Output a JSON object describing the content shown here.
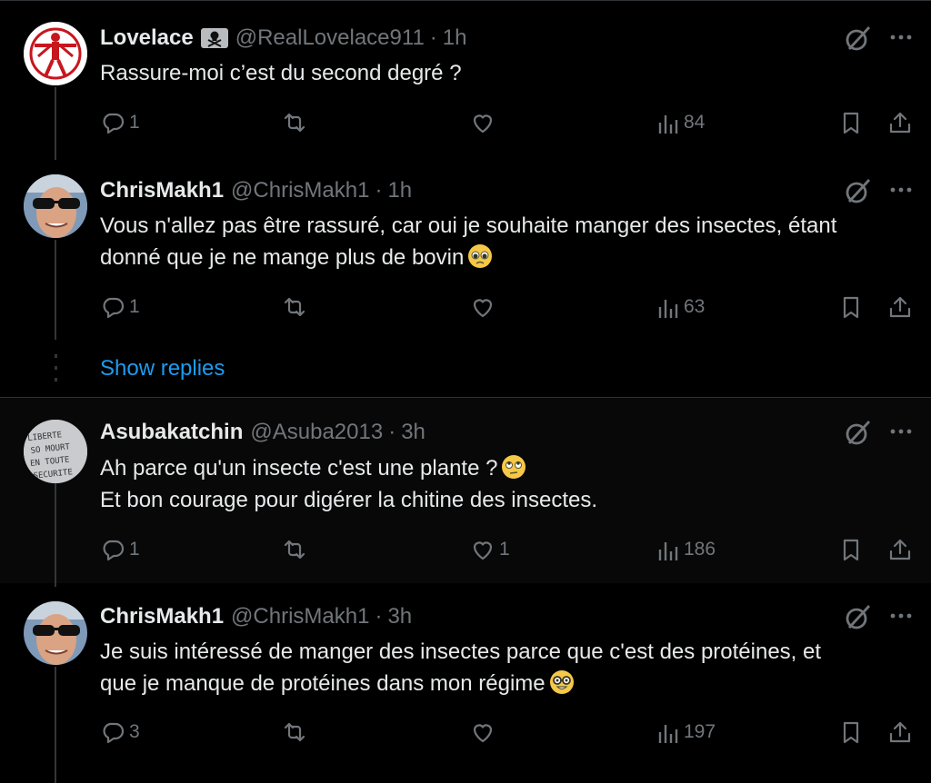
{
  "tweets": [
    {
      "name": "Lovelace",
      "handle": "@RealLovelace911",
      "time": "1h",
      "text_lines": [
        "Rassure-moi c’est du second degré ?"
      ],
      "reply_count": "1",
      "retweet_count": "",
      "like_count": "",
      "view_count": "84"
    },
    {
      "name": "ChrisMakh1",
      "handle": "@ChrisMakh1",
      "time": "1h",
      "text_lines": [
        "Vous n'allez pas être rassuré, car oui je souhaite manger des insectes, étant",
        "donné que je ne mange plus de bovin"
      ],
      "emoji": "pleading-face",
      "reply_count": "1",
      "retweet_count": "",
      "like_count": "",
      "view_count": "63"
    },
    {
      "name": "Asubakatchin",
      "handle": "@Asuba2013",
      "time": "3h",
      "text_lines": [
        "Ah parce qu'un insecte c'est une plante ?",
        "Et bon courage pour digérer la chitine des insectes."
      ],
      "emoji": "face-with-rolling-eyes",
      "reply_count": "1",
      "retweet_count": "",
      "like_count": "1",
      "view_count": "186"
    },
    {
      "name": "ChrisMakh1",
      "handle": "@ChrisMakh1",
      "time": "3h",
      "text_lines": [
        "Je suis intéressé de manger des insectes parce que c'est des protéines, et",
        "que je manque de protéines dans mon régime"
      ],
      "emoji": "nerd-face",
      "reply_count": "3",
      "retweet_count": "",
      "like_count": "",
      "view_count": "197"
    }
  ],
  "show_replies": "Show replies",
  "avatar_text": "LIBERTE SO MOURT EN TOUTE SECURITE",
  "colors": {
    "background": "#000000",
    "text": "#e7e9ea",
    "muted": "#71767b",
    "link": "#1d9bf0",
    "divider": "#2f3336"
  }
}
